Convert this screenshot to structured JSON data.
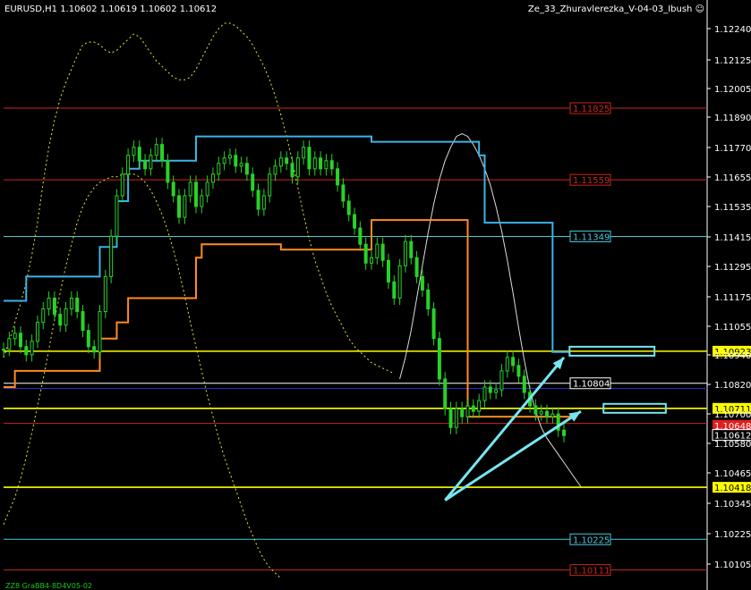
{
  "header": {
    "symbol_ohlc": "EURUSD,H1  1.10602 1.10619 1.10602 1.10612",
    "indicator": "Ze_33_Zhuravlerezka_V-04-03_Ibush"
  },
  "footer": {
    "text": "ZZ8 GraBB4-8D4V05-02"
  },
  "colors": {
    "background": "#000000",
    "candle": "#28d228",
    "axis_text": "#ffffff",
    "level_yellow": "#ffff00",
    "level_red": "#c8281e",
    "level_cyan": "#46c8dc",
    "level_blue": "#2832c8",
    "band_yellow": "#e6e632",
    "band_white": "#dcdcdc",
    "orange_channel": "#ff8c1e",
    "cyan_channel": "#3cb4e6",
    "arrow": "#78e6f0",
    "close_marker": "#ffff00"
  },
  "chart_data": {
    "type": "candlestick",
    "symbol": "EURUSD",
    "timeframe": "H1",
    "last": {
      "open": 1.10602,
      "high": 1.10619,
      "low": 1.10602,
      "close": 1.10612
    },
    "ylim": [
      1.1007,
      1.1216
    ],
    "y_ticks": [
      "1.12240",
      "1.12125",
      "1.12005",
      "1.11890",
      "1.11770",
      "1.11655",
      "1.11535",
      "1.11415",
      "1.11295",
      "1.11175",
      "1.11055",
      "1.10940",
      "1.10820",
      "1.10700",
      "1.10580",
      "1.10465",
      "1.10345",
      "1.10225",
      "1.10105"
    ],
    "levels": [
      {
        "price": 1.11825,
        "label": "1.11825",
        "kind": "red",
        "tag_side": "inner"
      },
      {
        "price": 1.11559,
        "label": "1.11559",
        "kind": "red",
        "tag_side": "inner"
      },
      {
        "price": 1.11349,
        "label": "1.11349",
        "kind": "cyan",
        "tag_side": "inner"
      },
      {
        "price": 1.10923,
        "label": "1.10923",
        "kind": "yellow",
        "tag_side": "axis"
      },
      {
        "price": 1.10804,
        "label": "1.10804",
        "kind": "white",
        "tag_side": "inner"
      },
      {
        "price": 1.10711,
        "label": "1.10711",
        "kind": "yellow",
        "tag_side": "axis"
      },
      {
        "price": 1.10418,
        "label": "1.10418",
        "kind": "yellow",
        "tag_side": "axis"
      },
      {
        "price": 1.10225,
        "label": "1.10225",
        "kind": "cyan",
        "tag_side": "inner"
      },
      {
        "price": 1.10111,
        "label": "1.10111",
        "kind": "red",
        "tag_side": "inner"
      }
    ],
    "extra_lines": [
      {
        "price": 1.10785,
        "kind": "blue"
      },
      {
        "price": 1.10655,
        "kind": "red"
      }
    ],
    "price_tag": {
      "price": 1.10612,
      "label": "1.10612"
    },
    "shadow_tag": {
      "price": 1.10648,
      "label": "1.10648"
    },
    "close_series": [
      1.1093,
      1.1097,
      1.1099,
      1.1094,
      1.1091,
      1.1096,
      1.1103,
      1.1108,
      1.1112,
      1.1106,
      1.1102,
      1.1108,
      1.1112,
      1.1107,
      1.11,
      1.1094,
      1.1092,
      1.1107,
      1.112,
      1.1135,
      1.115,
      1.1158,
      1.1165,
      1.1168,
      1.1163,
      1.116,
      1.1165,
      1.1169,
      1.1163,
      1.1155,
      1.115,
      1.1142,
      1.115,
      1.1155,
      1.1146,
      1.115,
      1.1155,
      1.1158,
      1.1162,
      1.1164,
      1.1165,
      1.1161,
      1.1162,
      1.1158,
      1.1152,
      1.1145,
      1.115,
      1.1158,
      1.1161,
      1.1164,
      1.1162,
      1.1157,
      1.1164,
      1.1168,
      1.116,
      1.1164,
      1.116,
      1.1163,
      1.116,
      1.1154,
      1.1148,
      1.1143,
      1.1138,
      1.1132,
      1.1125,
      1.1127,
      1.1132,
      1.1126,
      1.1118,
      1.1112,
      1.1124,
      1.1133,
      1.1127,
      1.112,
      1.1115,
      1.1108,
      1.1097,
      1.1082,
      1.1071,
      1.1064,
      1.1071,
      1.1068,
      1.1072,
      1.107,
      1.1074,
      1.1079,
      1.1077,
      1.1078,
      1.1085,
      1.109,
      1.1087,
      1.1083,
      1.1077,
      1.1072,
      1.1069,
      1.107,
      1.1068,
      1.1069,
      1.1063,
      1.1061
    ],
    "overlays": {
      "orange_channel": [
        [
          1.1079,
          1.1079,
          1.1085,
          1.1085,
          1.1085,
          1.1085,
          1.1085,
          1.1085,
          1.1085,
          1.1085,
          1.1085,
          1.1085,
          1.1085,
          1.1085,
          1.1085,
          1.1085,
          1.1085,
          1.1097,
          1.1097,
          1.1097,
          1.1103,
          1.1103,
          1.1112,
          1.1112,
          1.1112,
          1.1112,
          1.1112,
          1.1112,
          1.1112,
          1.1112,
          1.1112,
          1.1112,
          1.1112,
          1.1112,
          1.1127,
          1.1132,
          1.1132,
          1.1132,
          1.1132,
          1.1132,
          1.1132,
          1.1132,
          1.1132,
          1.1132,
          1.1132,
          1.1132,
          1.1132,
          1.1132,
          1.1132,
          1.113,
          1.113,
          1.113,
          1.113,
          1.113,
          1.113,
          1.113,
          1.113,
          1.113,
          1.113,
          1.113,
          1.113,
          1.113,
          1.113,
          1.113,
          1.113,
          1.1141,
          1.1141,
          1.1141,
          1.1141,
          1.1141,
          1.1141,
          1.1141,
          1.1141,
          1.1141,
          1.1141,
          1.1141,
          1.1141,
          1.1141,
          1.1141,
          1.1141,
          1.1141,
          1.1141,
          1.1068,
          1.1068,
          1.1068,
          1.1068,
          1.1068,
          1.1068,
          1.1068,
          1.1068,
          1.1068,
          1.1068,
          1.1068,
          1.1068,
          1.1068,
          1.1068,
          1.1068,
          1.1068,
          1.1068,
          1.1068,
          1.1068,
          1.1068
        ]
      ],
      "cyan_channel": [
        [
          1.1111,
          1.1111,
          1.1111,
          1.1111,
          1.112,
          1.112,
          1.112,
          1.112,
          1.112,
          1.112,
          1.112,
          1.112,
          1.112,
          1.112,
          1.112,
          1.112,
          1.112,
          1.1131,
          1.1131,
          1.1131,
          1.1148,
          1.1148,
          1.116,
          1.116,
          1.1163,
          1.1163,
          1.1163,
          1.1163,
          1.1163,
          1.1163,
          1.1163,
          1.1163,
          1.1163,
          1.1163,
          1.1172,
          1.1172,
          1.1172,
          1.1172,
          1.1172,
          1.1172,
          1.1172,
          1.1172,
          1.1172,
          1.1172,
          1.1172,
          1.1172,
          1.1172,
          1.1172,
          1.1172,
          1.1172,
          1.1172,
          1.1172,
          1.1172,
          1.1172,
          1.1172,
          1.1172,
          1.1172,
          1.1172,
          1.1172,
          1.1172,
          1.1172,
          1.1172,
          1.1172,
          1.1172,
          1.1172,
          1.117,
          1.117,
          1.117,
          1.117,
          1.117,
          1.117,
          1.117,
          1.117,
          1.117,
          1.117,
          1.117,
          1.117,
          1.117,
          1.117,
          1.117,
          1.117,
          1.117,
          1.117,
          1.117,
          1.1165,
          1.114,
          1.114,
          1.114,
          1.114,
          1.114,
          1.114,
          1.114,
          1.114,
          1.114,
          1.114,
          1.114,
          1.114,
          1.1092,
          1.1092,
          1.1092,
          1.1092
        ]
      ],
      "band_yellow_upper": [
        1.109,
        1.1096,
        1.1103,
        1.111,
        1.1118,
        1.1128,
        1.114,
        1.1155,
        1.1168,
        1.1178,
        1.1186,
        1.1192,
        1.1197,
        1.1202,
        1.1206,
        1.1207,
        1.1207,
        1.1206,
        1.1204,
        1.1203,
        1.1204,
        1.1206,
        1.1208,
        1.121,
        1.1209,
        1.1206,
        1.1203,
        1.12,
        1.1198,
        1.1196,
        1.1194,
        1.1193,
        1.1193,
        1.1194,
        1.1197,
        1.1201,
        1.1205,
        1.1209,
        1.1212,
        1.1214,
        1.1214,
        1.1213,
        1.1211,
        1.1209,
        1.1206,
        1.1202,
        1.1198,
        1.1193,
        1.1187,
        1.118,
        1.1172,
        1.1163,
        1.1153,
        1.1143,
        1.1134,
        1.1126,
        1.112,
        1.1114,
        1.1109,
        1.1105,
        1.1101,
        1.1097,
        1.1094,
        1.1092,
        1.109,
        1.1088,
        1.1087,
        1.1086,
        1.1085,
        1.1084
      ],
      "band_yellow_lower": [
        1.1028,
        1.1033,
        1.1038,
        1.1045,
        1.1053,
        1.1062,
        1.1072,
        1.1082,
        1.1093,
        1.1104,
        1.1114,
        1.1124,
        1.1132,
        1.114,
        1.1146,
        1.115,
        1.1153,
        1.1155,
        1.1156,
        1.1157,
        1.1157,
        1.1158,
        1.1158,
        1.1158,
        1.1157,
        1.1155,
        1.1152,
        1.1148,
        1.1143,
        1.1137,
        1.113,
        1.1122,
        1.1113,
        1.1103,
        1.1094,
        1.1085,
        1.1076,
        1.1068,
        1.106,
        1.1053,
        1.1047,
        1.1041,
        1.1035,
        1.1029,
        1.1024,
        1.1019,
        1.1015,
        1.1012,
        1.101,
        1.1008
      ],
      "band_white": [
        1.1082,
        1.109,
        1.11,
        1.1112,
        1.1124,
        1.1136,
        1.1147,
        1.1156,
        1.1163,
        1.1168,
        1.1172,
        1.1173,
        1.1172,
        1.1169,
        1.1165,
        1.116,
        1.1154,
        1.1146,
        1.1137,
        1.1126,
        1.1114,
        1.1101,
        1.1089,
        1.1078,
        1.107,
        1.1064,
        1.106,
        1.1057,
        1.1054,
        1.1051,
        1.1048,
        1.1045,
        1.1042
      ]
    },
    "arrows": [
      {
        "from_index": 78,
        "from_price": 1.1037,
        "to_index": 99,
        "to_price": 1.109
      },
      {
        "from_index": 78,
        "from_price": 1.1037,
        "to_index": 102,
        "to_price": 1.107
      }
    ],
    "boxes": [
      {
        "from_index": 100,
        "to_index": 115,
        "price": 1.10923
      },
      {
        "from_index": 106,
        "to_index": 117,
        "price": 1.10711
      }
    ]
  }
}
